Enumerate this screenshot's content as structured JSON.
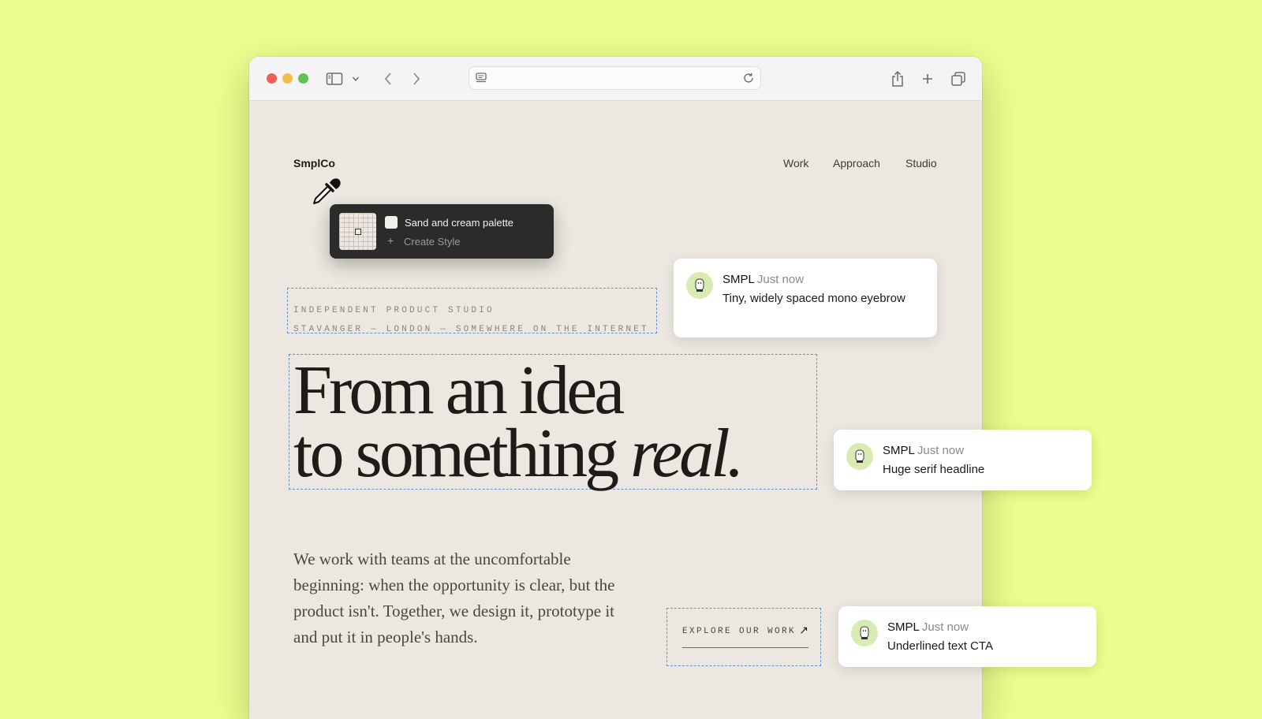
{
  "browser": {
    "toolbar_icons": [
      "sidebar-icon",
      "chevron-down-icon",
      "back-icon",
      "forward-icon",
      "reader-icon",
      "reload-icon",
      "share-icon",
      "plus-icon",
      "tabs-icon"
    ]
  },
  "site": {
    "logo": "SmplCo",
    "nav": [
      "Work",
      "Approach",
      "Studio"
    ],
    "eyebrow": [
      "INDEPENDENT PRODUCT STUDIO",
      "STAVANGER — LONDON — SOMEWHERE ON THE INTERNET"
    ],
    "headline": {
      "line1": "From an idea",
      "line2_prefix": "to something ",
      "line2_emphasis": "real."
    },
    "body": "We work with teams at the uncomfortable beginning: when the opportunity is clear, but the product isn't. Together, we design it, prototype it and put it in people's hands.",
    "cta": {
      "label": "EXPLORE OUR WORK",
      "arrow": "↗"
    }
  },
  "picker": {
    "style_name": "Sand and cream palette",
    "create_icon": "+",
    "create_label": "Create Style"
  },
  "comments": [
    {
      "author": "SMPL",
      "time": "Just now",
      "text": "Tiny, widely spaced mono eyebrow"
    },
    {
      "author": "SMPL",
      "time": "Just now",
      "text": "Huge serif headline"
    },
    {
      "author": "SMPL",
      "time": "Just now",
      "text": "Underlined text CTA"
    }
  ],
  "colors": {
    "background": "#ebfd8c",
    "page": "#ece7e1",
    "annotation_outline": "#6b93c9",
    "avatar": "#d7ebb3"
  }
}
